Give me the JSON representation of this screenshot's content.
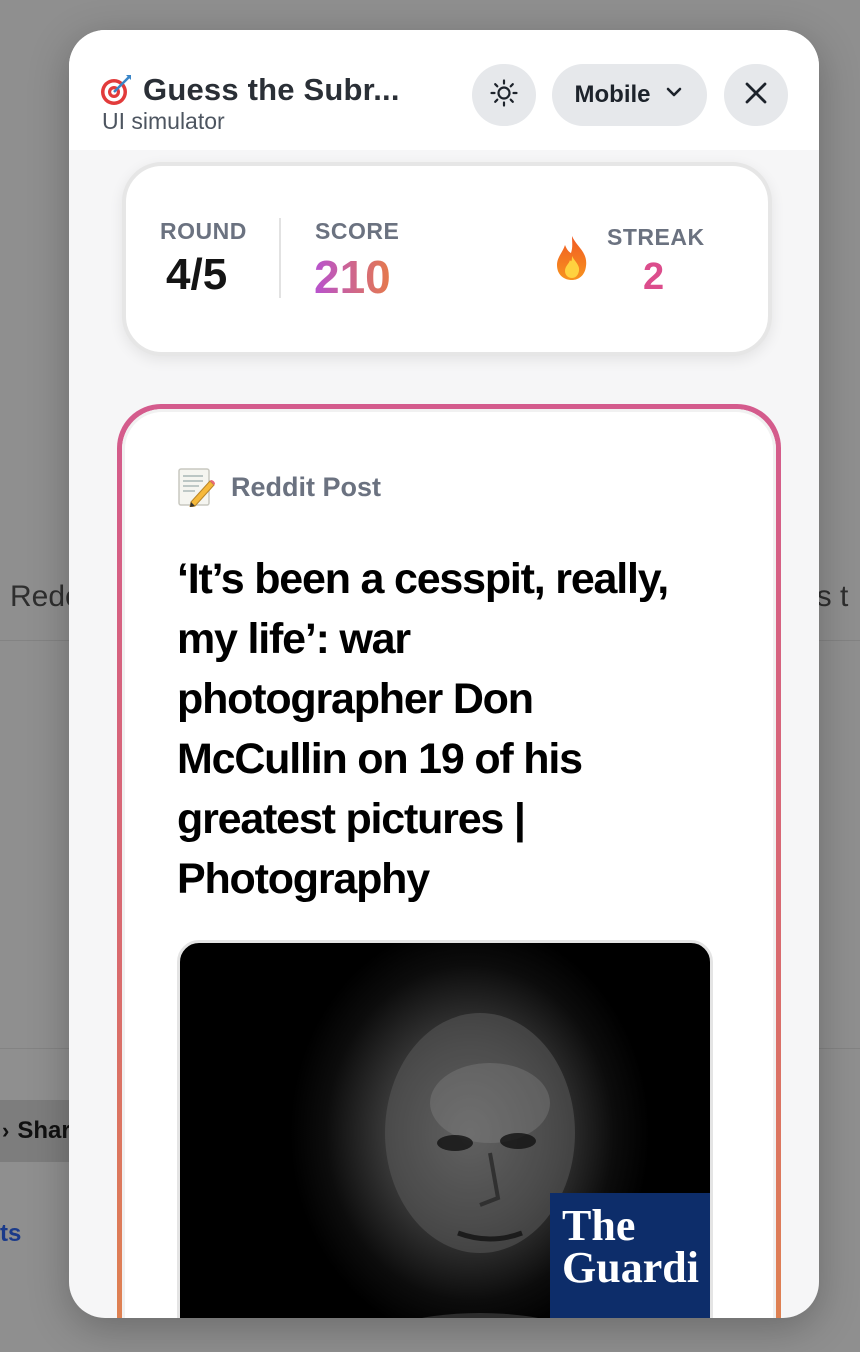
{
  "background": {
    "left_text": "Redc",
    "right_text": "gs t",
    "share_label": "Shar",
    "link_text": "ts"
  },
  "header": {
    "title": "Guess the Subr...",
    "subtitle": "UI simulator",
    "title_icon": "dart-target-icon",
    "device_select": {
      "selected": "Mobile"
    }
  },
  "stats": {
    "round_label": "ROUND",
    "round_value": "4/5",
    "score_label": "SCORE",
    "score_value": "210",
    "streak_label": "STREAK",
    "streak_value": "2",
    "streak_icon": "fire-icon"
  },
  "post": {
    "type_icon": "memo-icon",
    "type_label": "Reddit Post",
    "title": "‘It’s been a cesspit, really, my life’: war photographer Don McCullin on 19 of his greatest pictures | Photography",
    "image_badge": "The Guardi"
  },
  "colors": {
    "accent_gradient_start": "#b752d0",
    "accent_gradient_end": "#e67a4a",
    "streak_color": "#dc4d8c",
    "border_gradient_top": "#d45b8d",
    "border_gradient_bottom": "#e0874a"
  }
}
